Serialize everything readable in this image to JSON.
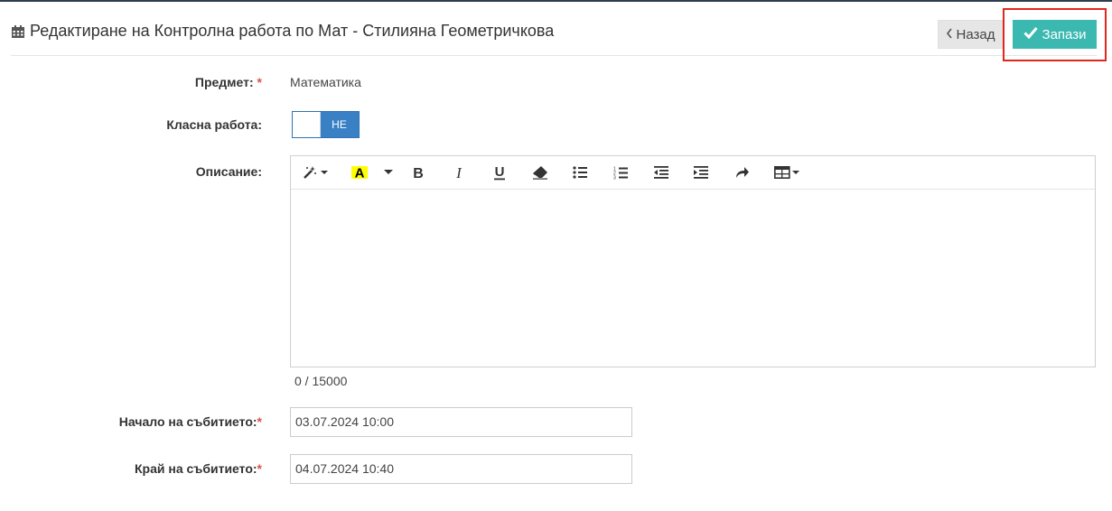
{
  "header": {
    "title": "Редактиране на Контролна работа по Мат - Стилияна Геометричкова",
    "back_label": "Назад",
    "save_label": "Запази"
  },
  "form": {
    "subject": {
      "label": "Предмет:",
      "required": "*",
      "value": "Математика"
    },
    "class_work": {
      "label": "Класна работа:",
      "toggle_text": "НЕ",
      "value": false
    },
    "description": {
      "label": "Описание:",
      "toolbar": [
        "magic-icon",
        "font-color-icon",
        "caret-down-icon",
        "bold-icon",
        "italic-icon",
        "underline-icon",
        "eraser-icon",
        "unordered-list-icon",
        "ordered-list-icon",
        "outdent-icon",
        "indent-icon",
        "redo-icon",
        "table-icon"
      ],
      "counter": "0 / 15000"
    },
    "start": {
      "label": "Начало на събитието:",
      "required": "*",
      "value": "03.07.2024 10:00"
    },
    "end": {
      "label": "Край на събитието:",
      "required": "*",
      "value": "04.07.2024 10:40"
    }
  },
  "colors": {
    "save": "#3bb8b0",
    "toggle": "#3a80c4",
    "required": "#d9534f",
    "highlight": "#e3261c"
  }
}
